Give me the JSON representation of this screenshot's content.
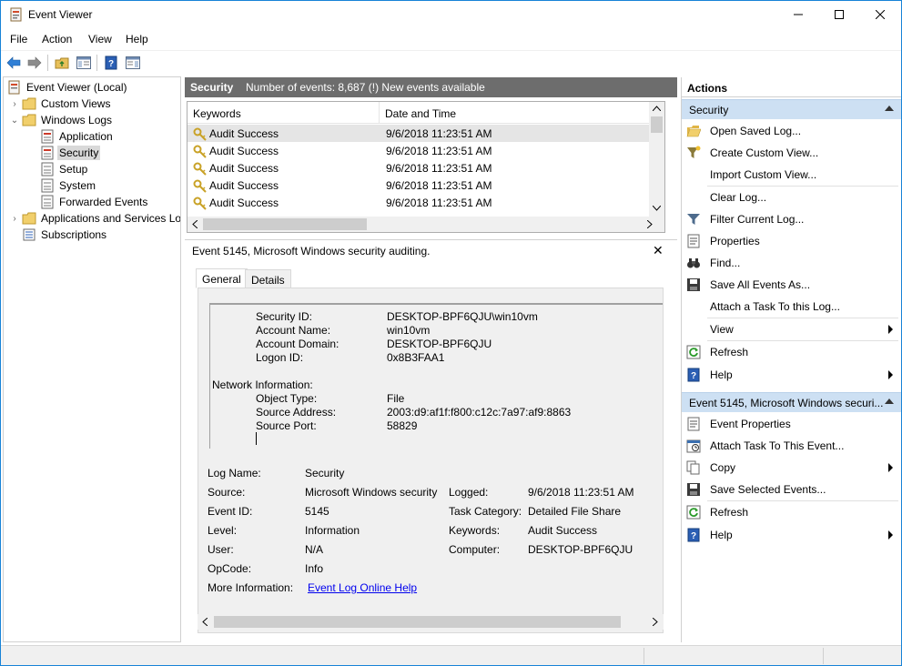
{
  "window": {
    "title": "Event Viewer"
  },
  "menu": [
    "File",
    "Action",
    "View",
    "Help"
  ],
  "tree": {
    "root": "Event Viewer (Local)",
    "custom_views": "Custom Views",
    "windows_logs": "Windows Logs",
    "logs": [
      "Application",
      "Security",
      "Setup",
      "System",
      "Forwarded Events"
    ],
    "apps_services": "Applications and Services Lo",
    "subscriptions": "Subscriptions"
  },
  "middle": {
    "log_name": "Security",
    "event_count": "Number of events: 8,687 (!) New events available",
    "columns": [
      "Keywords",
      "Date and Time"
    ],
    "events": [
      {
        "keyword": "Audit Success",
        "datetime": "9/6/2018 11:23:51 AM"
      },
      {
        "keyword": "Audit Success",
        "datetime": "9/6/2018 11:23:51 AM"
      },
      {
        "keyword": "Audit Success",
        "datetime": "9/6/2018 11:23:51 AM"
      },
      {
        "keyword": "Audit Success",
        "datetime": "9/6/2018 11:23:51 AM"
      },
      {
        "keyword": "Audit Success",
        "datetime": "9/6/2018 11:23:51 AM"
      }
    ]
  },
  "detail": {
    "title": "Event 5145, Microsoft Windows security auditing.",
    "tabs": [
      "General",
      "Details"
    ],
    "description": {
      "security_id_label": "Security ID:",
      "security_id": "DESKTOP-BPF6QJU\\win10vm",
      "account_name_label": "Account Name:",
      "account_name": "win10vm",
      "account_domain_label": "Account Domain:",
      "account_domain": "DESKTOP-BPF6QJU",
      "logon_id_label": "Logon ID:",
      "logon_id": "0x8B3FAA1",
      "network_info": "Network Information:",
      "object_type_label": "Object Type:",
      "object_type": "File",
      "source_address_label": "Source Address:",
      "source_address": "2003:d9:af1f:f800:c12c:7a97:af9:8863",
      "source_port_label": "Source Port:",
      "source_port": "58829"
    },
    "props": {
      "log_name_label": "Log Name:",
      "log_name": "Security",
      "source_label": "Source:",
      "source": "Microsoft Windows security",
      "logged_label": "Logged:",
      "logged": "9/6/2018 11:23:51 AM",
      "event_id_label": "Event ID:",
      "event_id": "5145",
      "task_category_label": "Task Category:",
      "task_category": "Detailed File Share",
      "level_label": "Level:",
      "level": "Information",
      "keywords_label": "Keywords:",
      "keywords": "Audit Success",
      "user_label": "User:",
      "user": "N/A",
      "computer_label": "Computer:",
      "computer": "DESKTOP-BPF6QJU",
      "opcode_label": "OpCode:",
      "opcode": "Info",
      "more_info_label": "More Information:",
      "more_info_link": "Event Log Online Help"
    }
  },
  "actions": {
    "title": "Actions",
    "section1": "Security",
    "section1_items": [
      "Open Saved Log...",
      "Create Custom View...",
      "Import Custom View...",
      "Clear Log...",
      "Filter Current Log...",
      "Properties",
      "Find...",
      "Save All Events As...",
      "Attach a Task To this Log...",
      "View",
      "Refresh",
      "Help"
    ],
    "section2": "Event 5145, Microsoft Windows securi...",
    "section2_items": [
      "Event Properties",
      "Attach Task To This Event...",
      "Copy",
      "Save Selected Events...",
      "Refresh",
      "Help"
    ]
  },
  "colors": {
    "accent": "#1883d7",
    "section_bg": "#cde0f3",
    "header_bg": "#6d6d6d",
    "link": "#0000ee"
  }
}
